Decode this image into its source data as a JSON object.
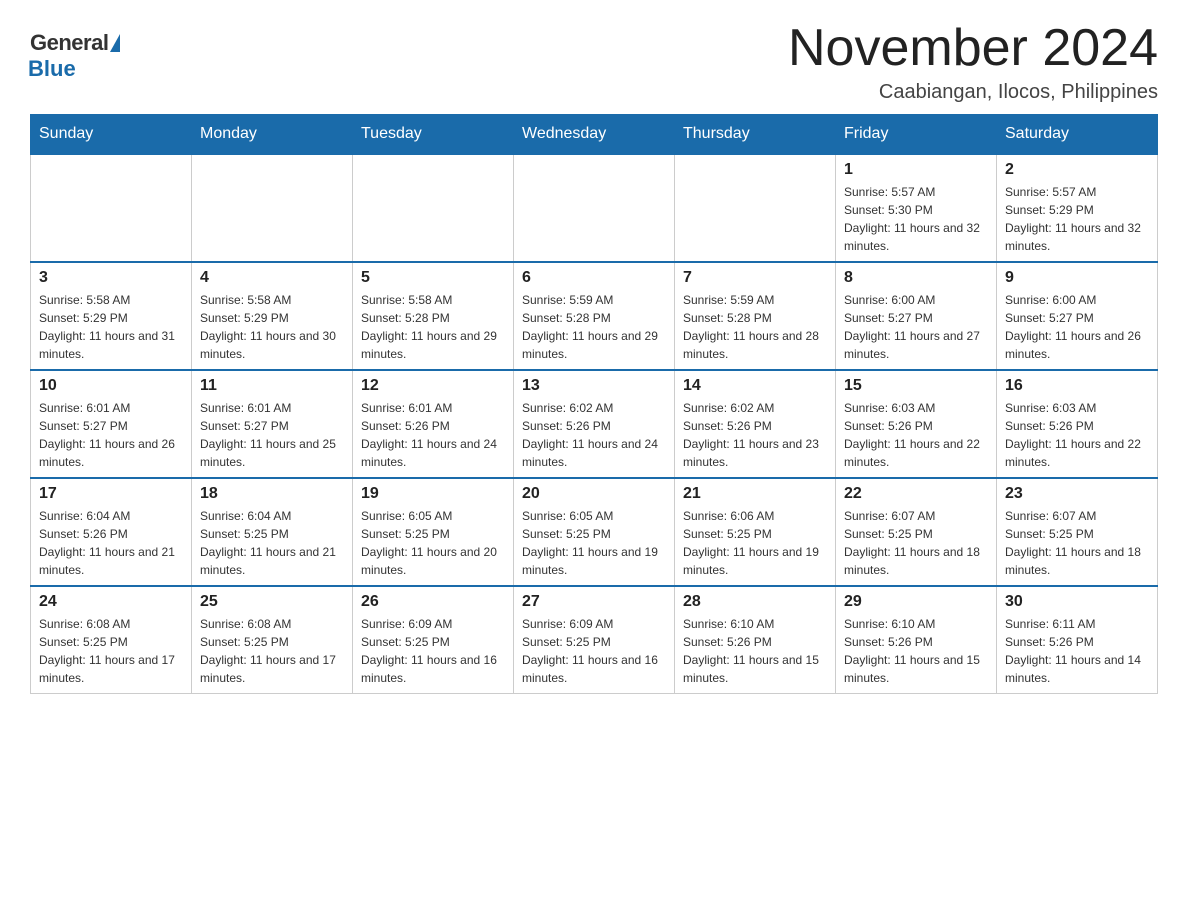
{
  "header": {
    "logo_general": "General",
    "logo_blue": "Blue",
    "month_title": "November 2024",
    "location": "Caabiangan, Ilocos, Philippines"
  },
  "weekdays": [
    "Sunday",
    "Monday",
    "Tuesday",
    "Wednesday",
    "Thursday",
    "Friday",
    "Saturday"
  ],
  "weeks": [
    [
      {
        "day": "",
        "info": ""
      },
      {
        "day": "",
        "info": ""
      },
      {
        "day": "",
        "info": ""
      },
      {
        "day": "",
        "info": ""
      },
      {
        "day": "",
        "info": ""
      },
      {
        "day": "1",
        "info": "Sunrise: 5:57 AM\nSunset: 5:30 PM\nDaylight: 11 hours and 32 minutes."
      },
      {
        "day": "2",
        "info": "Sunrise: 5:57 AM\nSunset: 5:29 PM\nDaylight: 11 hours and 32 minutes."
      }
    ],
    [
      {
        "day": "3",
        "info": "Sunrise: 5:58 AM\nSunset: 5:29 PM\nDaylight: 11 hours and 31 minutes."
      },
      {
        "day": "4",
        "info": "Sunrise: 5:58 AM\nSunset: 5:29 PM\nDaylight: 11 hours and 30 minutes."
      },
      {
        "day": "5",
        "info": "Sunrise: 5:58 AM\nSunset: 5:28 PM\nDaylight: 11 hours and 29 minutes."
      },
      {
        "day": "6",
        "info": "Sunrise: 5:59 AM\nSunset: 5:28 PM\nDaylight: 11 hours and 29 minutes."
      },
      {
        "day": "7",
        "info": "Sunrise: 5:59 AM\nSunset: 5:28 PM\nDaylight: 11 hours and 28 minutes."
      },
      {
        "day": "8",
        "info": "Sunrise: 6:00 AM\nSunset: 5:27 PM\nDaylight: 11 hours and 27 minutes."
      },
      {
        "day": "9",
        "info": "Sunrise: 6:00 AM\nSunset: 5:27 PM\nDaylight: 11 hours and 26 minutes."
      }
    ],
    [
      {
        "day": "10",
        "info": "Sunrise: 6:01 AM\nSunset: 5:27 PM\nDaylight: 11 hours and 26 minutes."
      },
      {
        "day": "11",
        "info": "Sunrise: 6:01 AM\nSunset: 5:27 PM\nDaylight: 11 hours and 25 minutes."
      },
      {
        "day": "12",
        "info": "Sunrise: 6:01 AM\nSunset: 5:26 PM\nDaylight: 11 hours and 24 minutes."
      },
      {
        "day": "13",
        "info": "Sunrise: 6:02 AM\nSunset: 5:26 PM\nDaylight: 11 hours and 24 minutes."
      },
      {
        "day": "14",
        "info": "Sunrise: 6:02 AM\nSunset: 5:26 PM\nDaylight: 11 hours and 23 minutes."
      },
      {
        "day": "15",
        "info": "Sunrise: 6:03 AM\nSunset: 5:26 PM\nDaylight: 11 hours and 22 minutes."
      },
      {
        "day": "16",
        "info": "Sunrise: 6:03 AM\nSunset: 5:26 PM\nDaylight: 11 hours and 22 minutes."
      }
    ],
    [
      {
        "day": "17",
        "info": "Sunrise: 6:04 AM\nSunset: 5:26 PM\nDaylight: 11 hours and 21 minutes."
      },
      {
        "day": "18",
        "info": "Sunrise: 6:04 AM\nSunset: 5:25 PM\nDaylight: 11 hours and 21 minutes."
      },
      {
        "day": "19",
        "info": "Sunrise: 6:05 AM\nSunset: 5:25 PM\nDaylight: 11 hours and 20 minutes."
      },
      {
        "day": "20",
        "info": "Sunrise: 6:05 AM\nSunset: 5:25 PM\nDaylight: 11 hours and 19 minutes."
      },
      {
        "day": "21",
        "info": "Sunrise: 6:06 AM\nSunset: 5:25 PM\nDaylight: 11 hours and 19 minutes."
      },
      {
        "day": "22",
        "info": "Sunrise: 6:07 AM\nSunset: 5:25 PM\nDaylight: 11 hours and 18 minutes."
      },
      {
        "day": "23",
        "info": "Sunrise: 6:07 AM\nSunset: 5:25 PM\nDaylight: 11 hours and 18 minutes."
      }
    ],
    [
      {
        "day": "24",
        "info": "Sunrise: 6:08 AM\nSunset: 5:25 PM\nDaylight: 11 hours and 17 minutes."
      },
      {
        "day": "25",
        "info": "Sunrise: 6:08 AM\nSunset: 5:25 PM\nDaylight: 11 hours and 17 minutes."
      },
      {
        "day": "26",
        "info": "Sunrise: 6:09 AM\nSunset: 5:25 PM\nDaylight: 11 hours and 16 minutes."
      },
      {
        "day": "27",
        "info": "Sunrise: 6:09 AM\nSunset: 5:25 PM\nDaylight: 11 hours and 16 minutes."
      },
      {
        "day": "28",
        "info": "Sunrise: 6:10 AM\nSunset: 5:26 PM\nDaylight: 11 hours and 15 minutes."
      },
      {
        "day": "29",
        "info": "Sunrise: 6:10 AM\nSunset: 5:26 PM\nDaylight: 11 hours and 15 minutes."
      },
      {
        "day": "30",
        "info": "Sunrise: 6:11 AM\nSunset: 5:26 PM\nDaylight: 11 hours and 14 minutes."
      }
    ]
  ]
}
